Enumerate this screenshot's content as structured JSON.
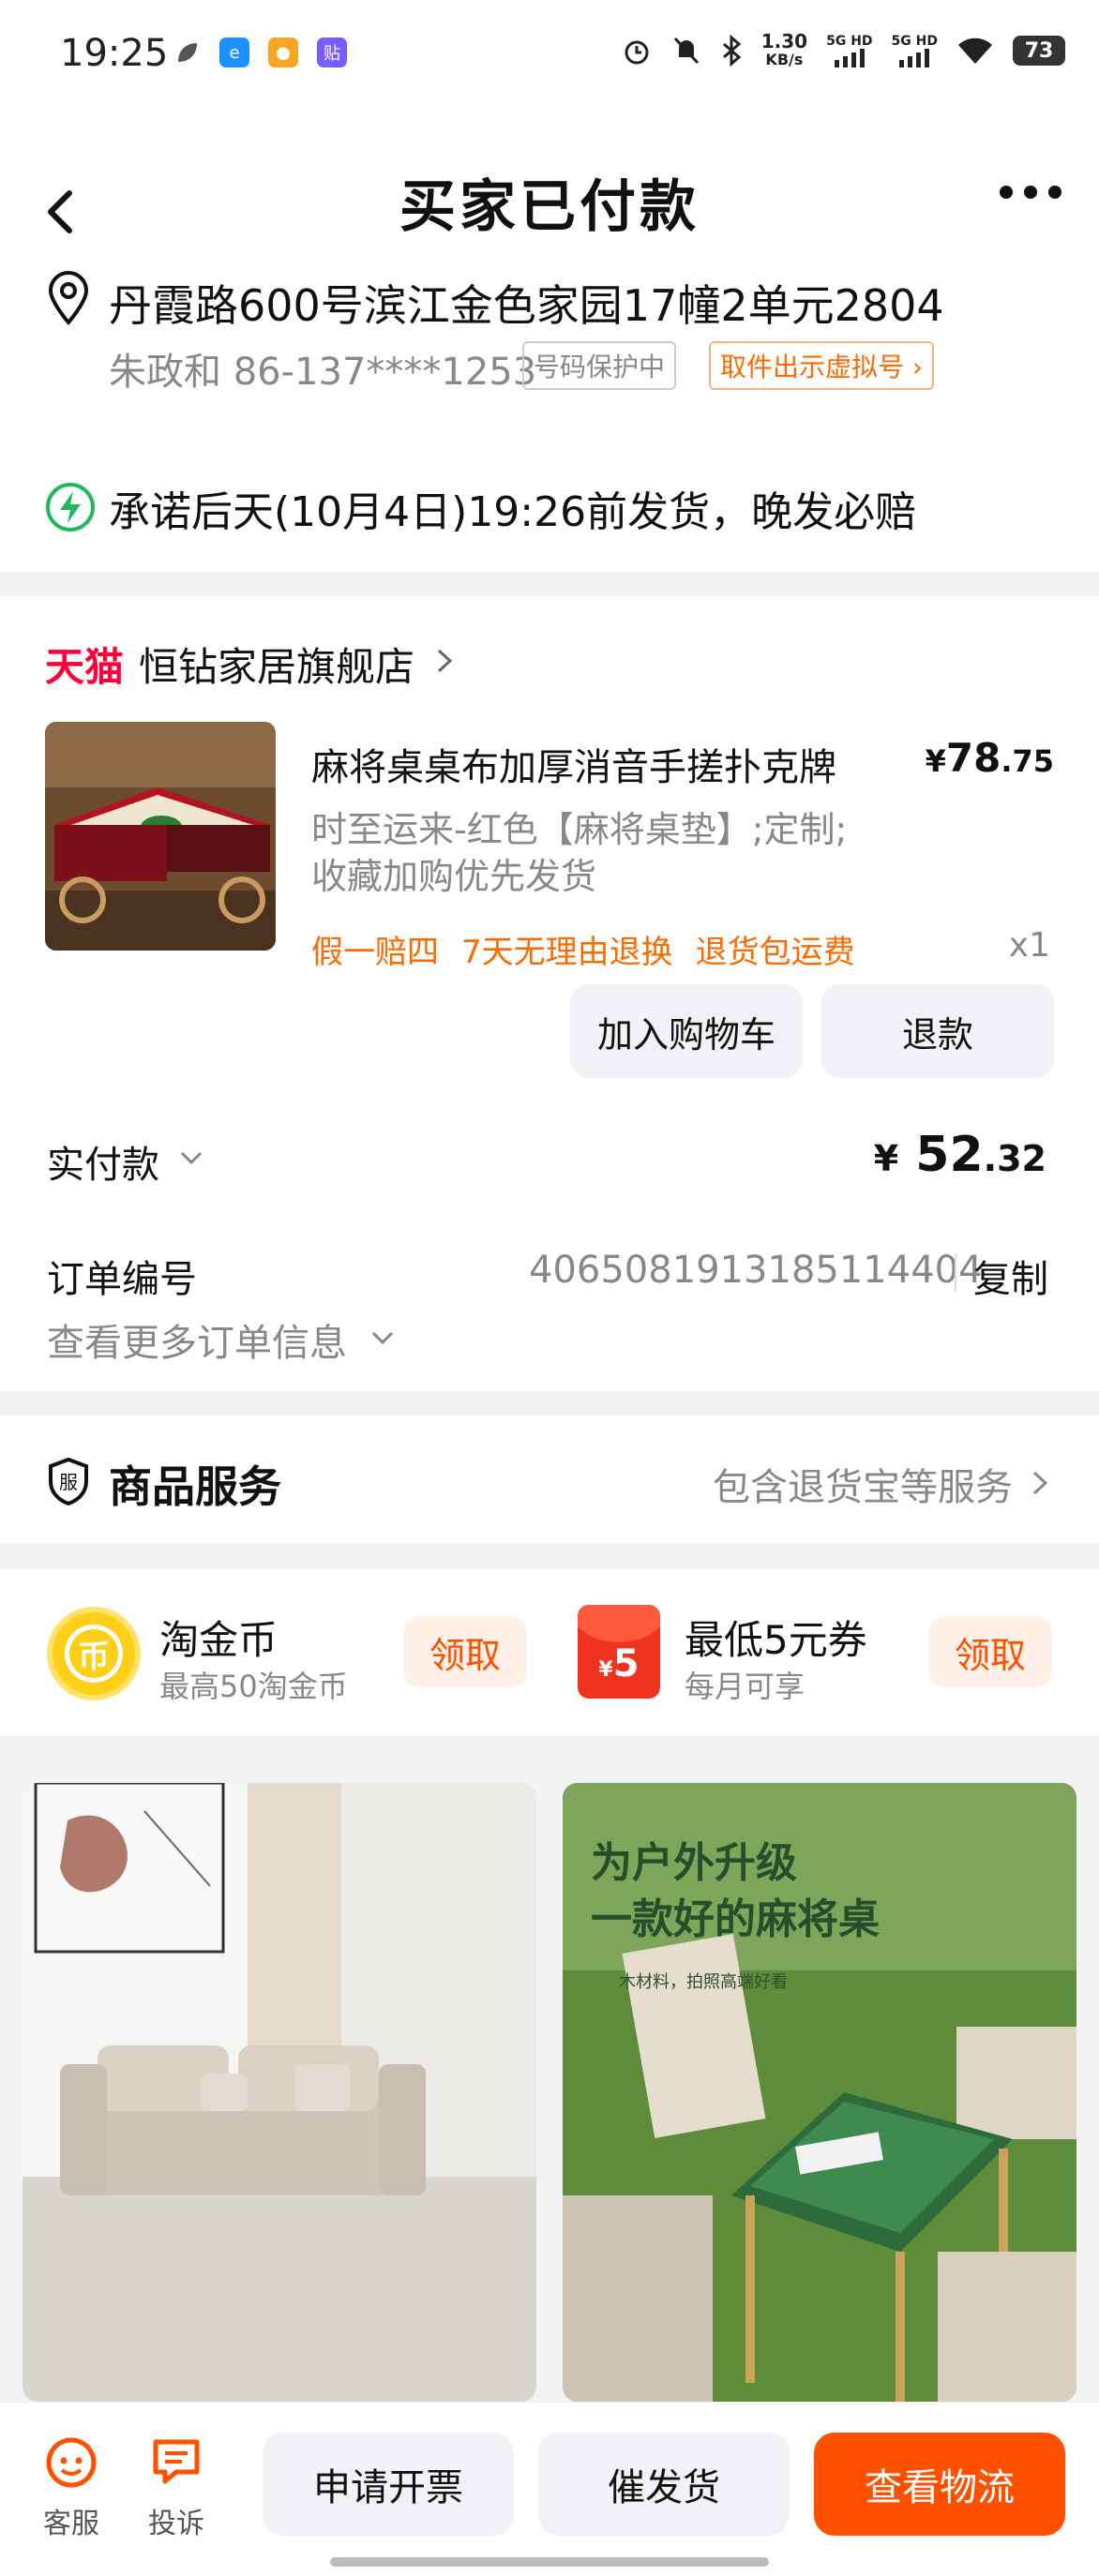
{
  "status_bar": {
    "time": "19:25",
    "net_speed_value": "1.30",
    "net_speed_unit": "KB/s",
    "sim1": "5G HD",
    "sim2": "5G HD",
    "battery": "73"
  },
  "header": {
    "title": "买家已付款",
    "address": "丹霞路600号滨江金色家园17幢2单元2804",
    "contact": "朱政和 86-137****1253",
    "protect_tag": "号码保护中",
    "virtual_tag": "取件出示虚拟号 ›"
  },
  "promise": {
    "text": "承诺后天(10月4日)19:26前发货，晚发必赔"
  },
  "order": {
    "tmall_logo": "天猫",
    "store_name": "恒钻家居旗舰店",
    "product_title": "麻将桌桌布加厚消音手搓扑克牌",
    "price_currency": "¥",
    "price_int": "78",
    "price_dec": ".75",
    "spec_line1": "时至运来-红色【麻将桌垫】;定制;",
    "spec_line2": "收藏加购优先发货",
    "badges": [
      "假一赔四",
      "7天无理由退换",
      "退货包运费"
    ],
    "quantity": "x1",
    "add_cart_label": "加入购物车",
    "refund_label": "退款",
    "paid_label": "实付款",
    "paid_currency": "¥",
    "paid_int": "52",
    "paid_dec": ".32",
    "order_no_label": "订单编号",
    "order_no": "4065081913185114404",
    "copy_label": "复制",
    "more_info_label": "查看更多订单信息"
  },
  "service": {
    "icon_text": "服",
    "title": "商品服务",
    "subtitle": "包含退货宝等服务"
  },
  "coupons": [
    {
      "title": "淘金币",
      "subtitle": "最高50淘金币",
      "claim": "领取",
      "icon_text": "币"
    },
    {
      "title": "最低5元券",
      "subtitle": "每月可享",
      "claim": "领取",
      "icon_amount": "5",
      "icon_currency": "¥"
    }
  ],
  "recommendations": {
    "card2_line1": "为户外升级",
    "card2_line2": "一款好的麻将桌",
    "card2_small": "木材料，拍照高端好看"
  },
  "bottom_bar": {
    "service_label": "客服",
    "complain_label": "投诉",
    "invoice_label": "申请开票",
    "urge_label": "催发货",
    "logistics_label": "查看物流"
  },
  "colors": {
    "accent_orange": "#ff5000",
    "tmall_red": "#ff0036",
    "promise_green": "#1fb85a"
  }
}
